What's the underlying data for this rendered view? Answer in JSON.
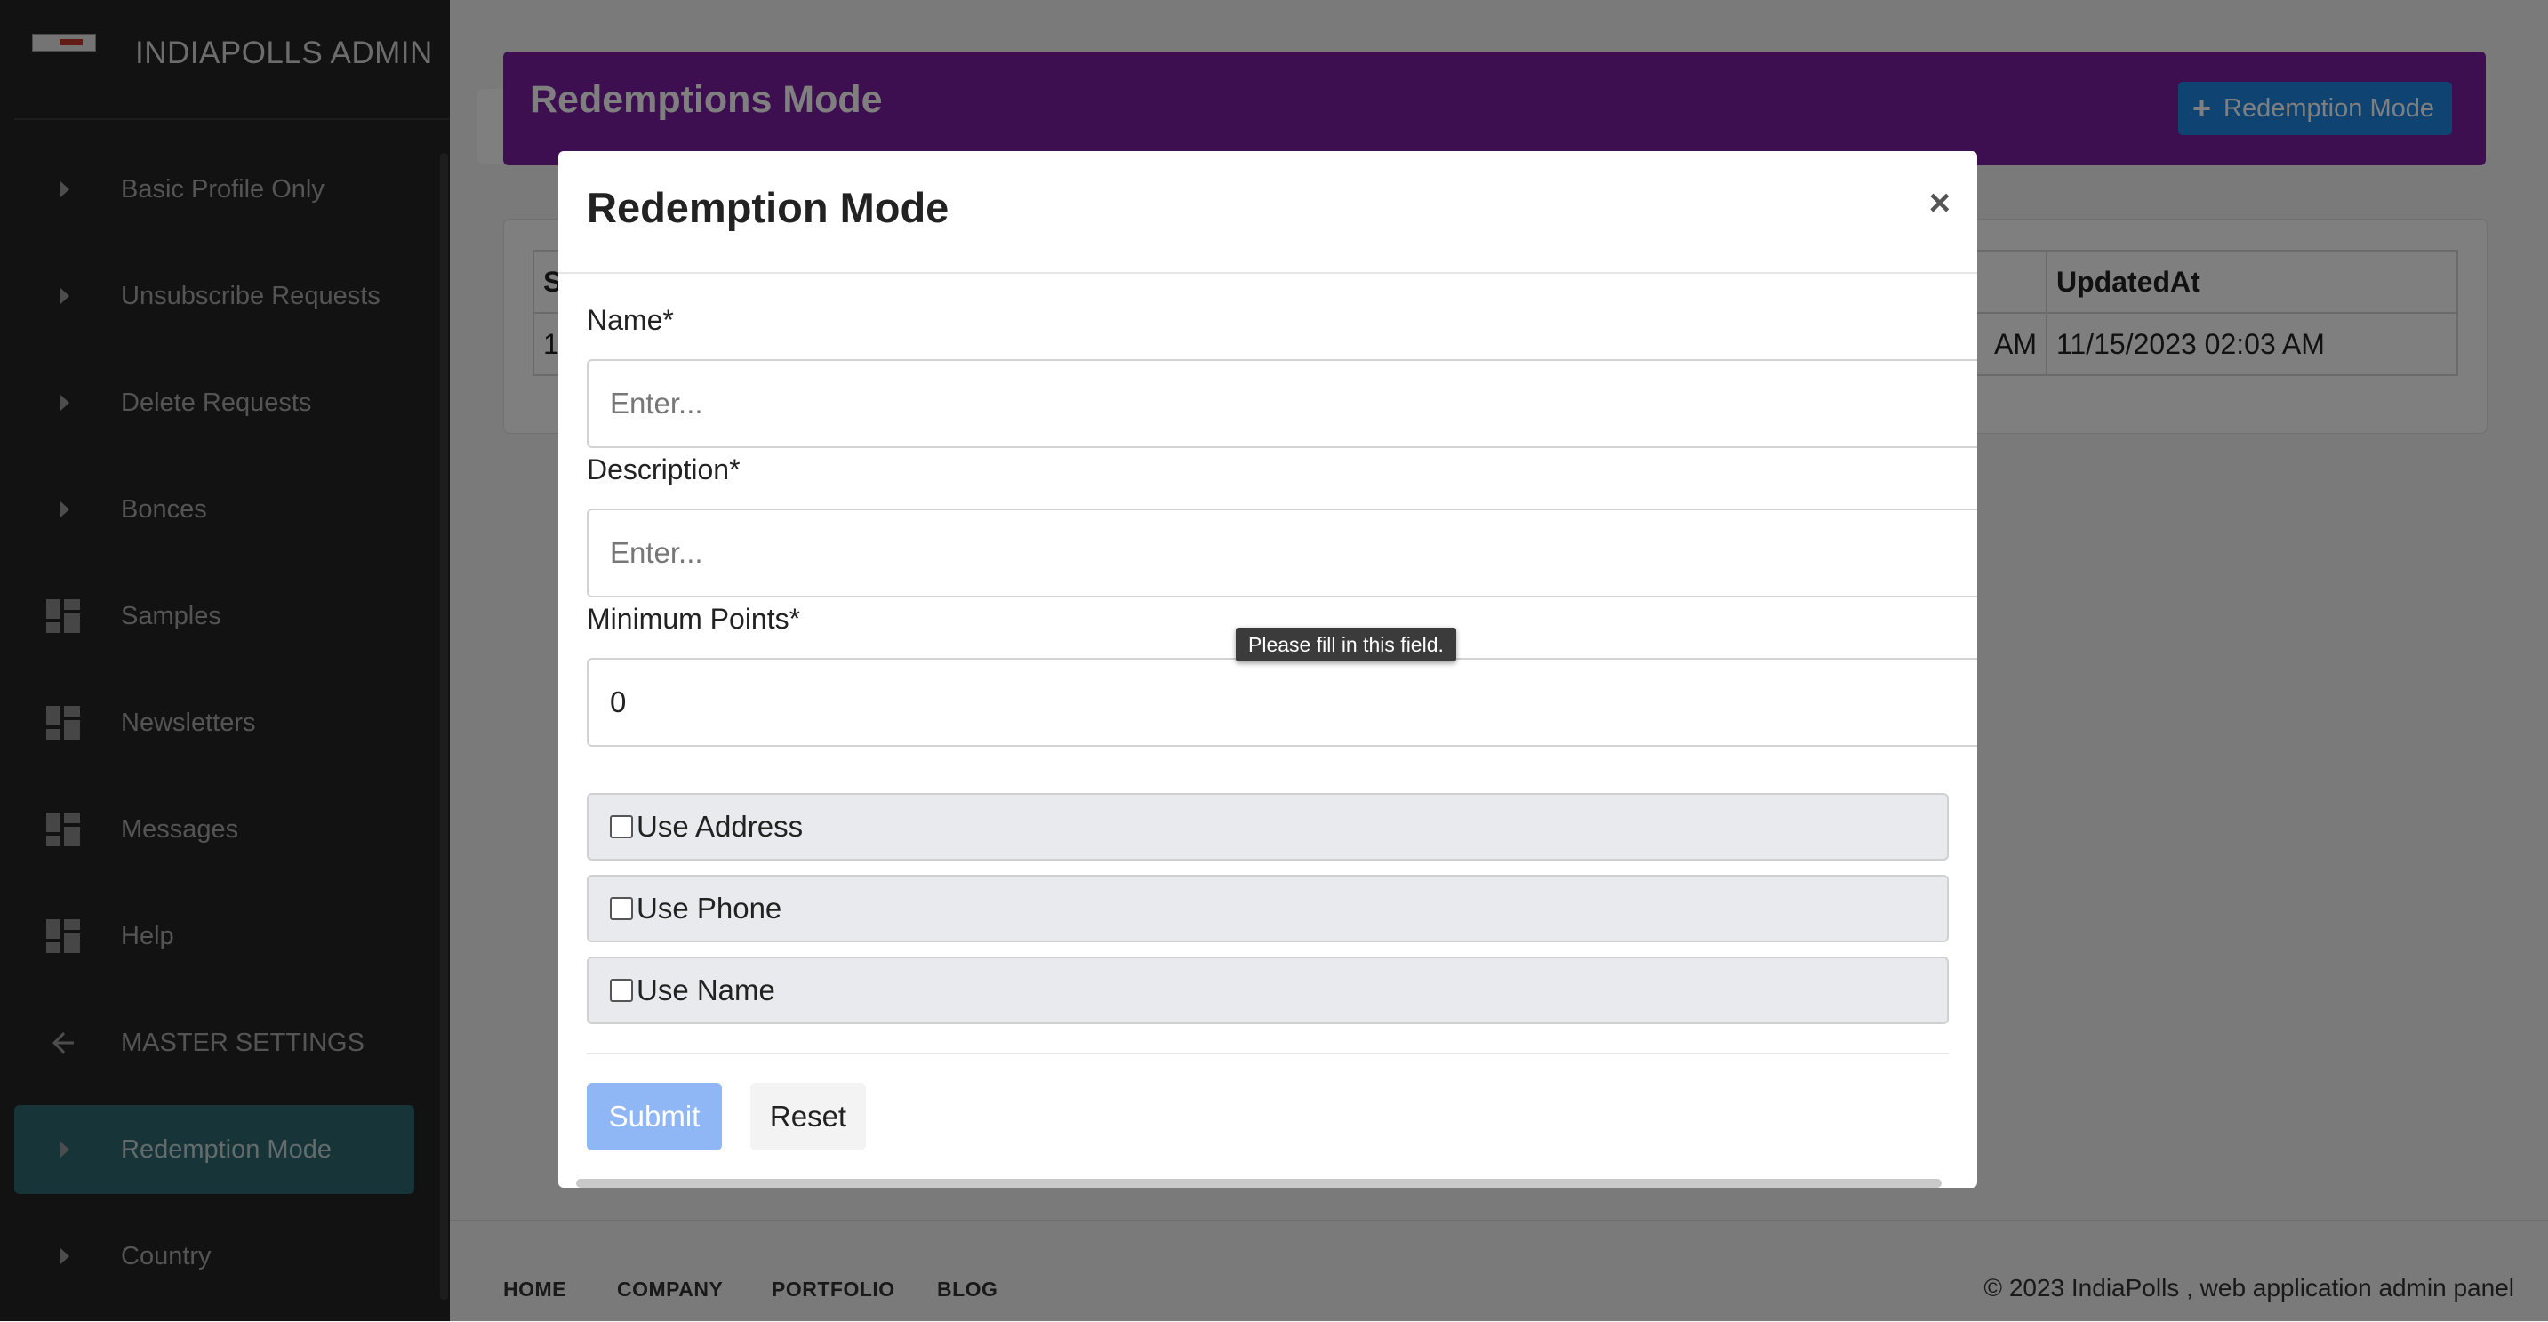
{
  "sidebar": {
    "brand_title": "INDIAPOLLS ADMIN",
    "items": [
      {
        "label": "Basic Profile Only",
        "icon": "caret-right-icon"
      },
      {
        "label": "Unsubscribe Requests",
        "icon": "caret-right-icon"
      },
      {
        "label": "Delete Requests",
        "icon": "caret-right-icon"
      },
      {
        "label": "Bonces",
        "icon": "caret-right-icon"
      },
      {
        "label": "Samples",
        "icon": "dashboard-icon"
      },
      {
        "label": "Newsletters",
        "icon": "dashboard-icon"
      },
      {
        "label": "Messages",
        "icon": "dashboard-icon"
      },
      {
        "label": "Help",
        "icon": "dashboard-icon"
      },
      {
        "label": "MASTER SETTINGS",
        "icon": "arrow-left-icon"
      },
      {
        "label": "Redemption Mode",
        "icon": "caret-right-icon",
        "active": true
      },
      {
        "label": "Country",
        "icon": "caret-right-icon"
      }
    ]
  },
  "header": {
    "title": "Redemptions Mode",
    "add_button_label": "Redemption Mode",
    "accent_color": "#7b1fa2",
    "button_color": "#1e88e5"
  },
  "table": {
    "first_header_fragment": "S",
    "updated_header": "UpdatedAt",
    "row_first_fragment": "1",
    "row_created_fragment": "AM",
    "row_updated": "11/15/2023 02:03 AM"
  },
  "modal": {
    "title": "Redemption Mode",
    "close_symbol": "×",
    "name_label": "Name*",
    "name_placeholder": "Enter...",
    "description_label": "Description*",
    "description_placeholder": "Enter...",
    "min_points_label": "Minimum Points*",
    "min_points_value": "0",
    "checkboxes": [
      {
        "label": "Use Address",
        "checked": false
      },
      {
        "label": "Use Phone",
        "checked": false
      },
      {
        "label": "Use Name",
        "checked": false
      }
    ],
    "submit_label": "Submit",
    "reset_label": "Reset",
    "tooltip": "Please fill in this field."
  },
  "footer": {
    "links": [
      "HOME",
      "COMPANY",
      "PORTFOLIO",
      "BLOG"
    ],
    "copyright": "© 2023 IndiaPolls , web application admin panel"
  }
}
